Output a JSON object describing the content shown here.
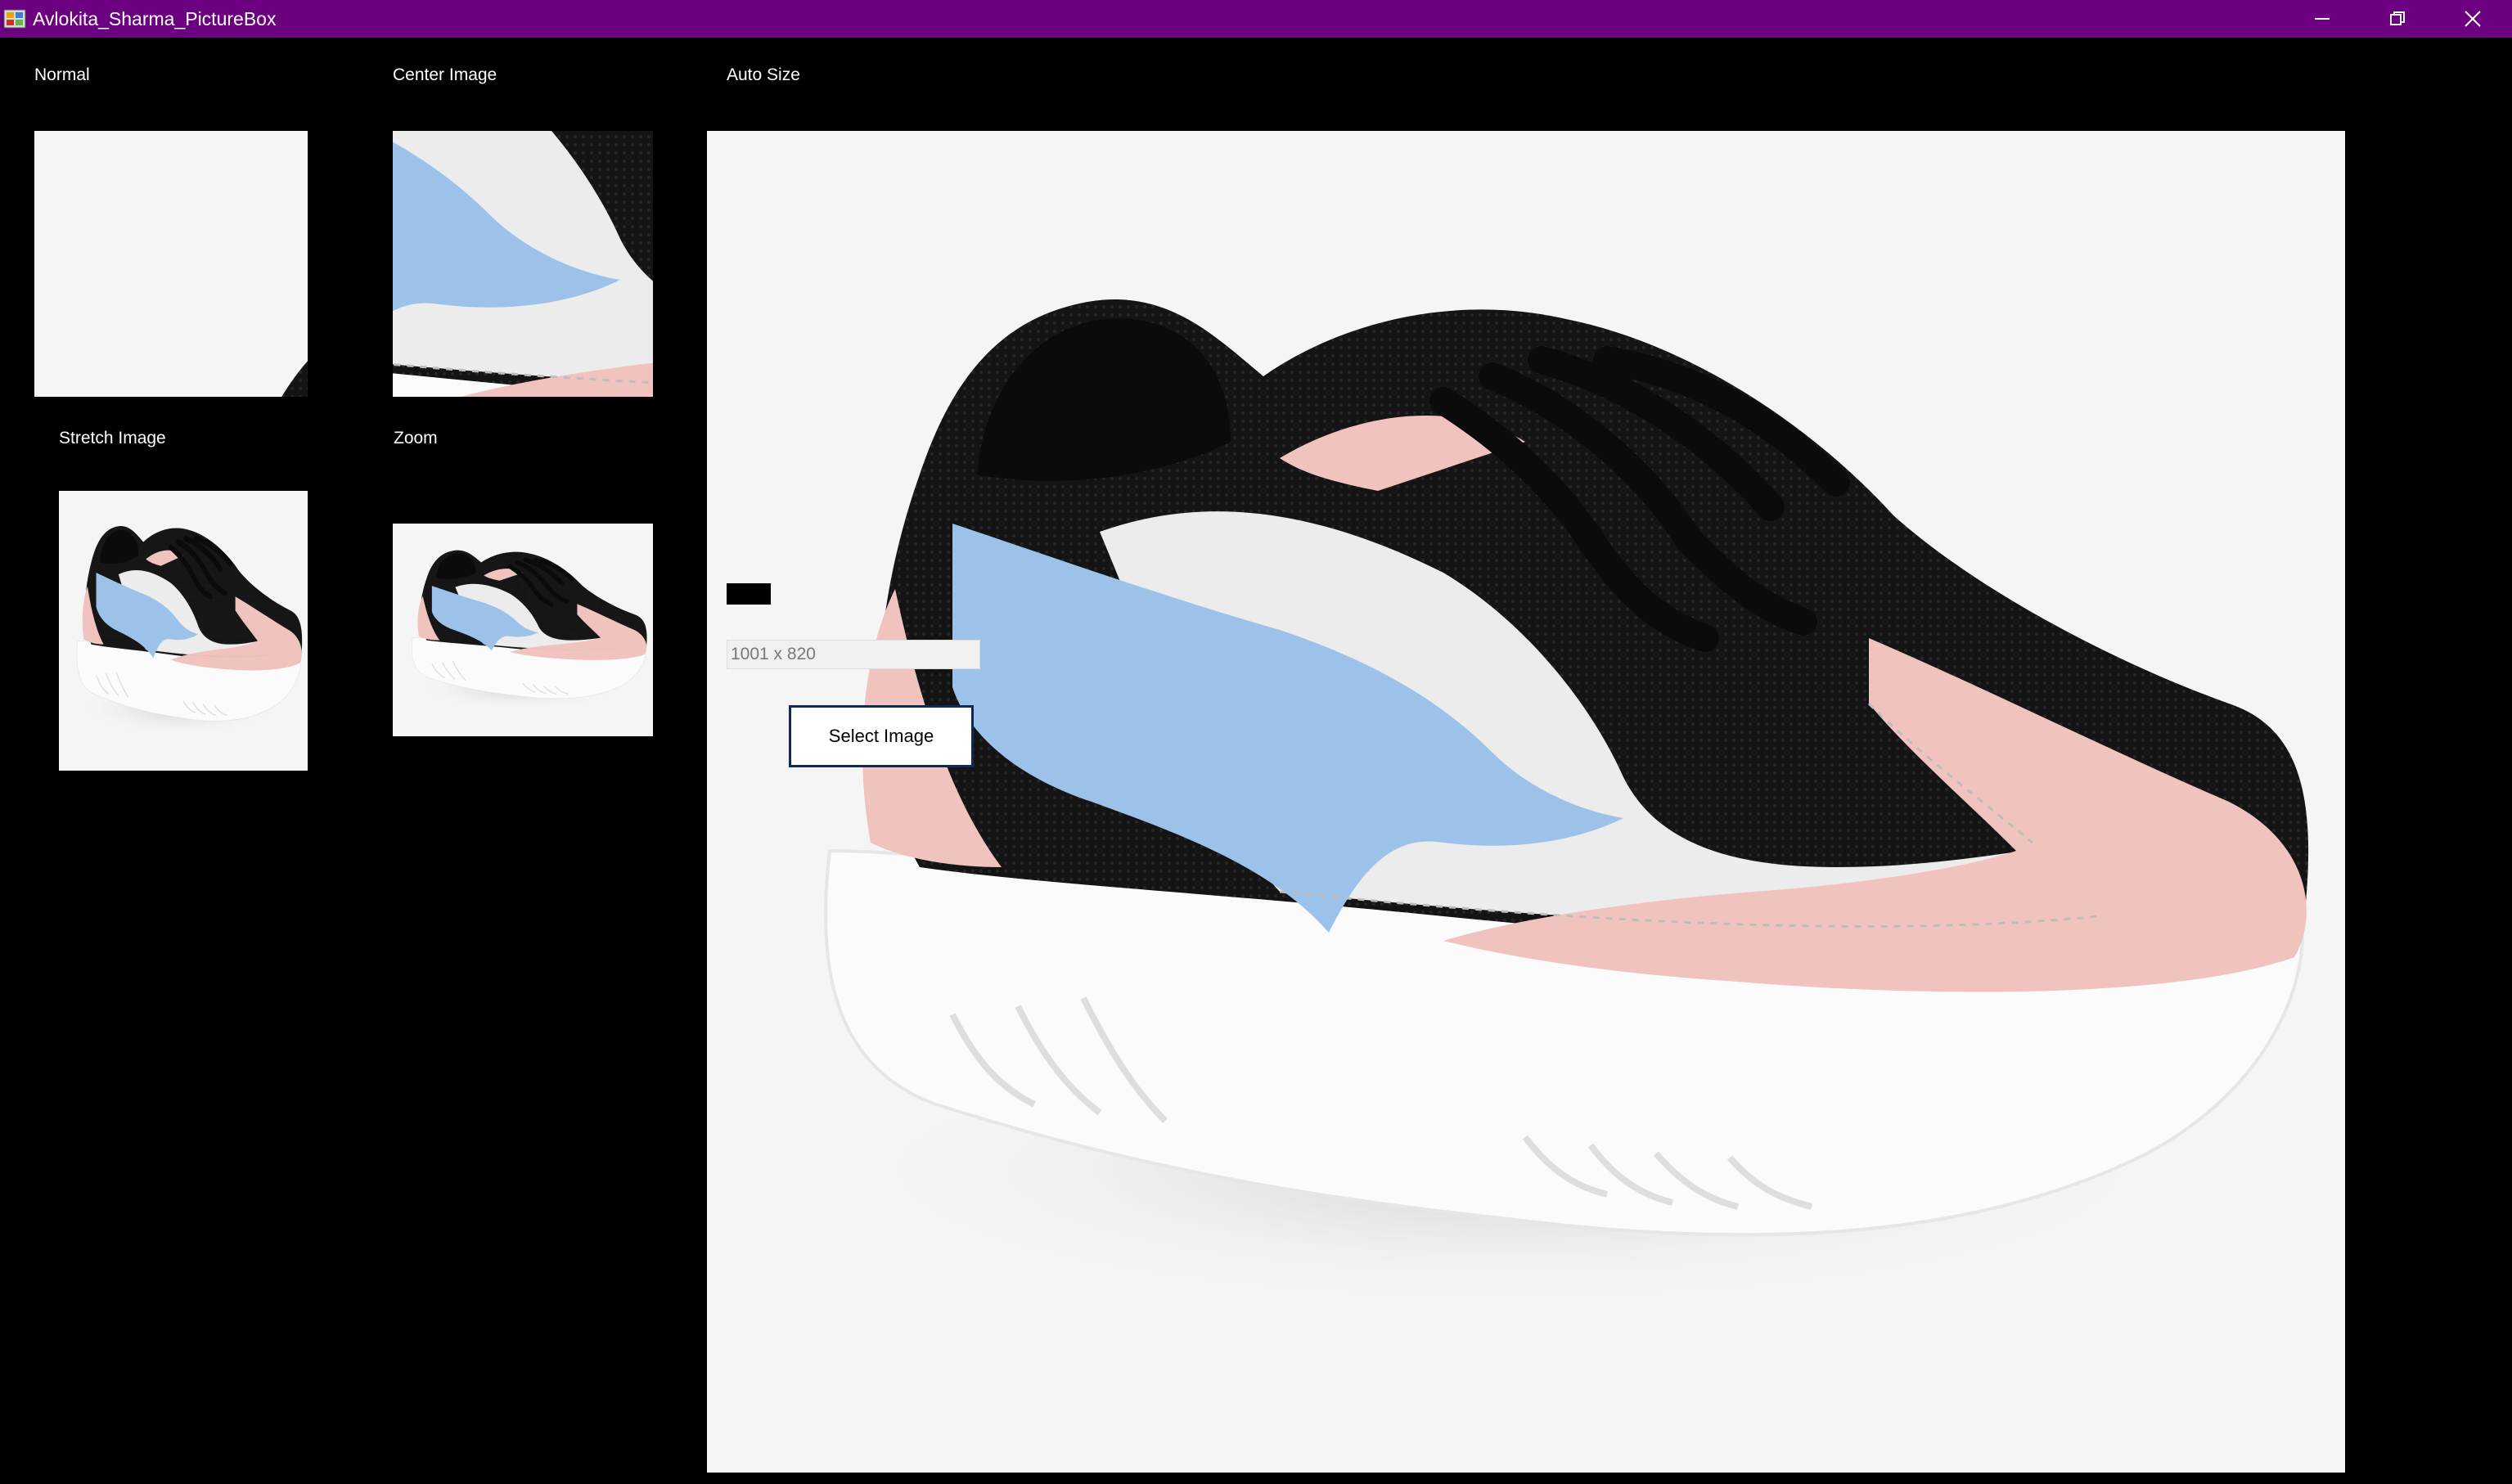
{
  "window": {
    "title": "Avlokita_Sharma_PictureBox",
    "titlebar_color": "#6b0080",
    "background": "#000000",
    "controls": [
      "minimize-icon",
      "restore-icon",
      "close-icon"
    ]
  },
  "labels": {
    "normal": "Normal",
    "center_image": "Center Image",
    "auto_size": "Auto Size",
    "stretch_image": "Stretch Image",
    "zoom": "Zoom"
  },
  "size_display": {
    "value": "1001 x 820"
  },
  "select_button": {
    "label": "Select Image"
  },
  "image": {
    "subject": "sneaker",
    "colors": {
      "background": "#f5f5f5",
      "sole": "#fbfbfb",
      "mesh": "#141414",
      "blue_panel": "#9cc2ea",
      "pink_panel": "#f1c3bf",
      "white_panel": "#ececec"
    }
  }
}
